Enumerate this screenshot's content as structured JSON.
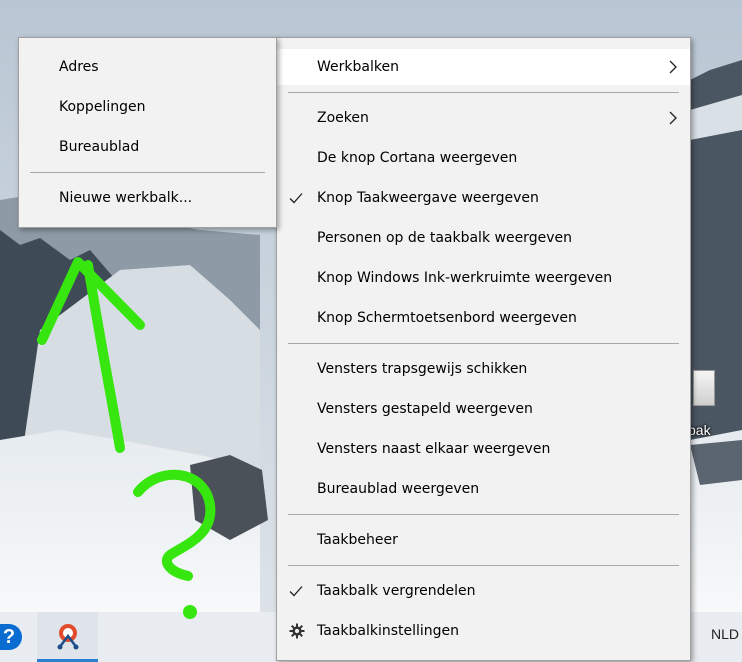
{
  "context_menu": {
    "items": [
      {
        "label": "Werkbalken"
      },
      {
        "label": "Zoeken"
      },
      {
        "label": "De knop Cortana weergeven"
      },
      {
        "label": "Knop Taakweergave weergeven"
      },
      {
        "label": "Personen op de taakbalk weergeven"
      },
      {
        "label": "Knop Windows Ink-werkruimte weergeven"
      },
      {
        "label": "Knop Schermtoetsenbord weergeven"
      },
      {
        "label": "Vensters trapsgewijs schikken"
      },
      {
        "label": "Vensters gestapeld weergeven"
      },
      {
        "label": "Vensters naast elkaar weergeven"
      },
      {
        "label": "Bureaublad weergeven"
      },
      {
        "label": "Taakbeheer"
      },
      {
        "label": "Taakbalk vergrendelen"
      },
      {
        "label": "Taakbalkinstellingen"
      }
    ]
  },
  "toolbars_submenu": {
    "items": [
      {
        "label": "Adres"
      },
      {
        "label": "Koppelingen"
      },
      {
        "label": "Bureaublad"
      },
      {
        "label": "Nieuwe werkbalk..."
      }
    ]
  },
  "desktop": {
    "icon_label": "bak"
  },
  "taskbar": {
    "help_glyph": "?",
    "language": "NLD",
    "tray_glyph": ")"
  },
  "colors": {
    "menu_bg": "#f2f2f2",
    "menu_hover": "#ffffff",
    "annotation": "#37e60f",
    "taskbar_accent": "#2d7fd2"
  }
}
